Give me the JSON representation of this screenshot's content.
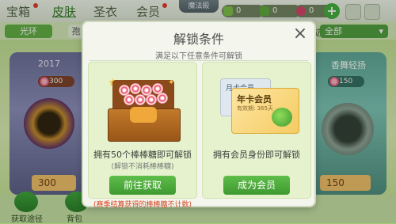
{
  "topbar": {
    "tabs": [
      {
        "label": "宝箱",
        "active": false,
        "dot": true
      },
      {
        "label": "皮肤",
        "active": true,
        "dot": false
      },
      {
        "label": "圣衣",
        "active": false,
        "dot": false
      },
      {
        "label": "会员",
        "active": false,
        "dot": true
      }
    ],
    "center_badge": "魔法殿",
    "currencies": [
      {
        "value": "0",
        "color": "#7bbf4a"
      },
      {
        "value": "0",
        "color": "#5aa83a"
      },
      {
        "value": "0",
        "color": "#d63d6a"
      }
    ],
    "plus_label": "+"
  },
  "filter": {
    "pill": "光环",
    "pill2": "孢",
    "label": "筛选:",
    "select": "全部"
  },
  "cards": {
    "left": {
      "name": "2017",
      "price": "300"
    },
    "right": {
      "name": "香舞轻扬",
      "price": "150"
    }
  },
  "bottom": {
    "price_left": "300",
    "price_right": "150",
    "btn_left": "获取途径",
    "btn_right": "背包"
  },
  "modal": {
    "title": "解锁条件",
    "close": "×",
    "subtitle": "满足以下任意条件可解锁",
    "left": {
      "text": "拥有50个棒棒糖即可解锁",
      "note": "(解锁不消耗棒棒糖)",
      "button": "前往获取",
      "warning": "(赛季结算获得的棒棒糖不计数)"
    },
    "right": {
      "card_back": "月卡会员",
      "card_front": "年卡会员",
      "card_front_sub": "有效期: 365天",
      "text": "拥有会员身份即可解锁",
      "button": "成为会员"
    }
  }
}
